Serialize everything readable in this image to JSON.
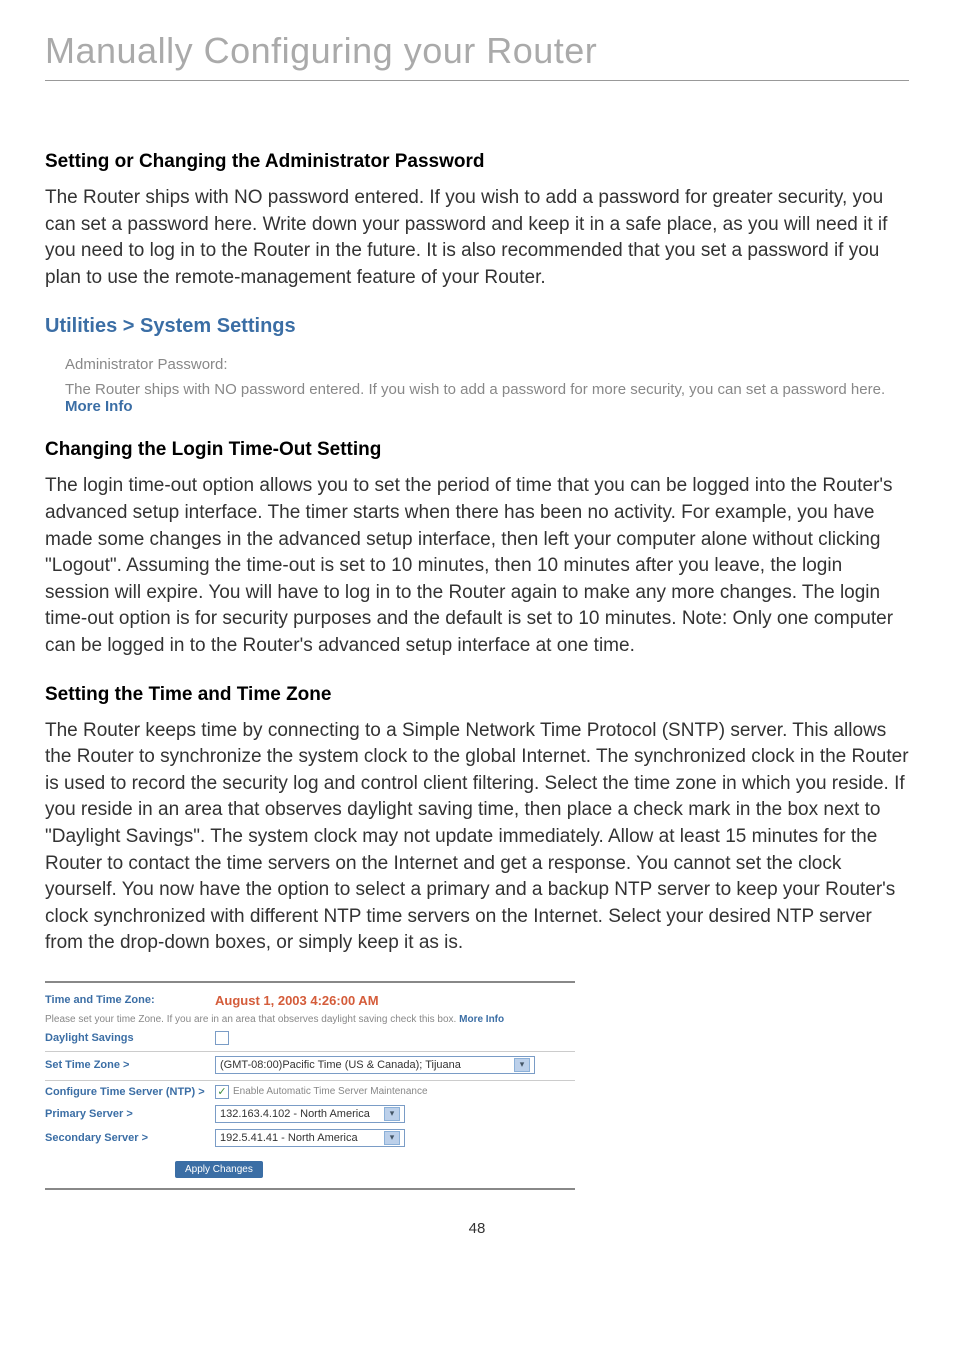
{
  "page_title": "Manually Configuring your Router",
  "section1": {
    "heading": "Setting or Changing the Administrator Password",
    "body": "The Router ships with NO password entered. If you wish to add a password for greater security, you can set a password here. Write down your password and keep it in a safe place, as you will need it if you need to log in to the Router in the future. It is also recommended that you set a password if you plan to use the remote-management feature of your Router."
  },
  "utilities": {
    "heading": "Utilities > System Settings",
    "admin_label": "Administrator Password:",
    "desc": "The Router ships with NO password entered. If you wish to add a password for more security, you can set a password here. ",
    "more_info": "More Info"
  },
  "section2": {
    "heading": "Changing the Login Time-Out Setting",
    "body": "The login time-out option allows you to set the period of time that you can be logged into the Router's advanced setup interface. The timer starts when there has been no activity. For example, you have made some changes in the advanced setup interface, then left your computer alone without clicking \"Logout\". Assuming the time-out is set to 10 minutes, then 10 minutes after you leave, the login session will expire. You will have to log in to the Router again to make any more changes. The login time-out option is for security purposes and the default is set to 10 minutes. Note: Only one computer can be logged in to the Router's advanced setup interface at one time."
  },
  "section3": {
    "heading": "Setting the Time and Time Zone",
    "body": "The Router keeps time by connecting to a Simple Network Time Protocol (SNTP) server. This allows the Router to synchronize the system clock to the global Internet. The synchronized clock in the Router is used to record the security log and control client filtering. Select the time zone in which you reside. If you reside in an area that observes daylight saving time, then place a check mark in the box next to \"Daylight Savings\". The system clock may not update immediately. Allow at least 15 minutes for the Router to contact the time servers on the Internet and get a response. You cannot set the clock yourself. You now have the option to select a primary and a backup NTP server to keep your Router's clock synchronized with different NTP time servers on the Internet. Select your desired NTP server from the drop-down boxes, or simply keep it as is."
  },
  "time_panel": {
    "time_label": "Time and Time Zone:",
    "time_value": "August 1, 2003 4:26:00 AM",
    "desc": "Please set your time Zone. If you are in an area that observes daylight saving check this box. ",
    "more_info": "More Info",
    "daylight_label": "Daylight Savings",
    "set_zone_label": "Set Time Zone >",
    "zone_value": "(GMT-08:00)Pacific Time (US & Canada); Tijuana",
    "config_ntp_label": "Configure Time Server (NTP) >",
    "enable_text": "Enable Automatic Time Server Maintenance",
    "primary_label": "Primary Server >",
    "primary_value": "132.163.4.102 - North America",
    "secondary_label": "Secondary Server >",
    "secondary_value": "192.5.41.41 - North America",
    "apply_label": "Apply Changes"
  },
  "page_number": "48"
}
